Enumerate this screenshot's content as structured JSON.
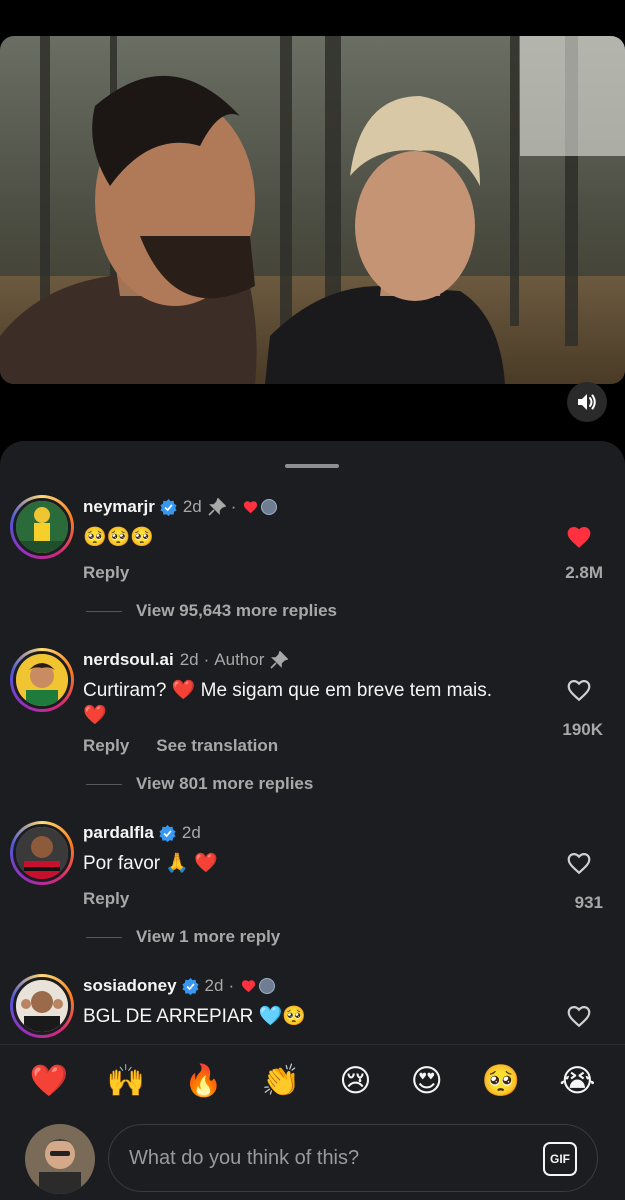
{
  "video": {
    "audio_icon": "speaker-icon"
  },
  "comments": [
    {
      "username": "neymarjr",
      "verified": true,
      "time": "2d",
      "pinned": true,
      "liked_by_author": true,
      "text": "🥺🥺🥺",
      "reply_label": "Reply",
      "liked": true,
      "like_count": "2.8M",
      "view_replies": "View 95,643 more replies"
    },
    {
      "username": "nerdsoul.ai",
      "verified": false,
      "time": "2d",
      "author_label": "Author",
      "pinned": true,
      "text": "Curtiram? ❤️ Me sigam que em breve tem mais. ❤️",
      "reply_label": "Reply",
      "translate_label": "See translation",
      "liked": false,
      "like_count": "190K",
      "view_replies": "View 801 more replies"
    },
    {
      "username": "pardalfla",
      "verified": true,
      "time": "2d",
      "text": "Por favor 🙏 ❤️",
      "reply_label": "Reply",
      "liked": false,
      "like_count": "931",
      "view_replies": "View 1 more reply"
    },
    {
      "username": "sosiadoney",
      "verified": true,
      "time": "2d",
      "liked_by_author": true,
      "text": "BGL DE ARREPIAR 🩵🥺",
      "liked": false
    }
  ],
  "quick_reactions": [
    "❤️",
    "🙌",
    "🔥",
    "👏",
    "😢",
    "😍",
    "🥺",
    "😭"
  ],
  "composer": {
    "placeholder": "What do you think of this?",
    "gif_label": "GIF"
  },
  "colors": {
    "sheet_bg": "#1c1d20",
    "like_red": "#ff3040",
    "verified_blue": "#3897f0",
    "muted_text": "#a8a8a8"
  }
}
